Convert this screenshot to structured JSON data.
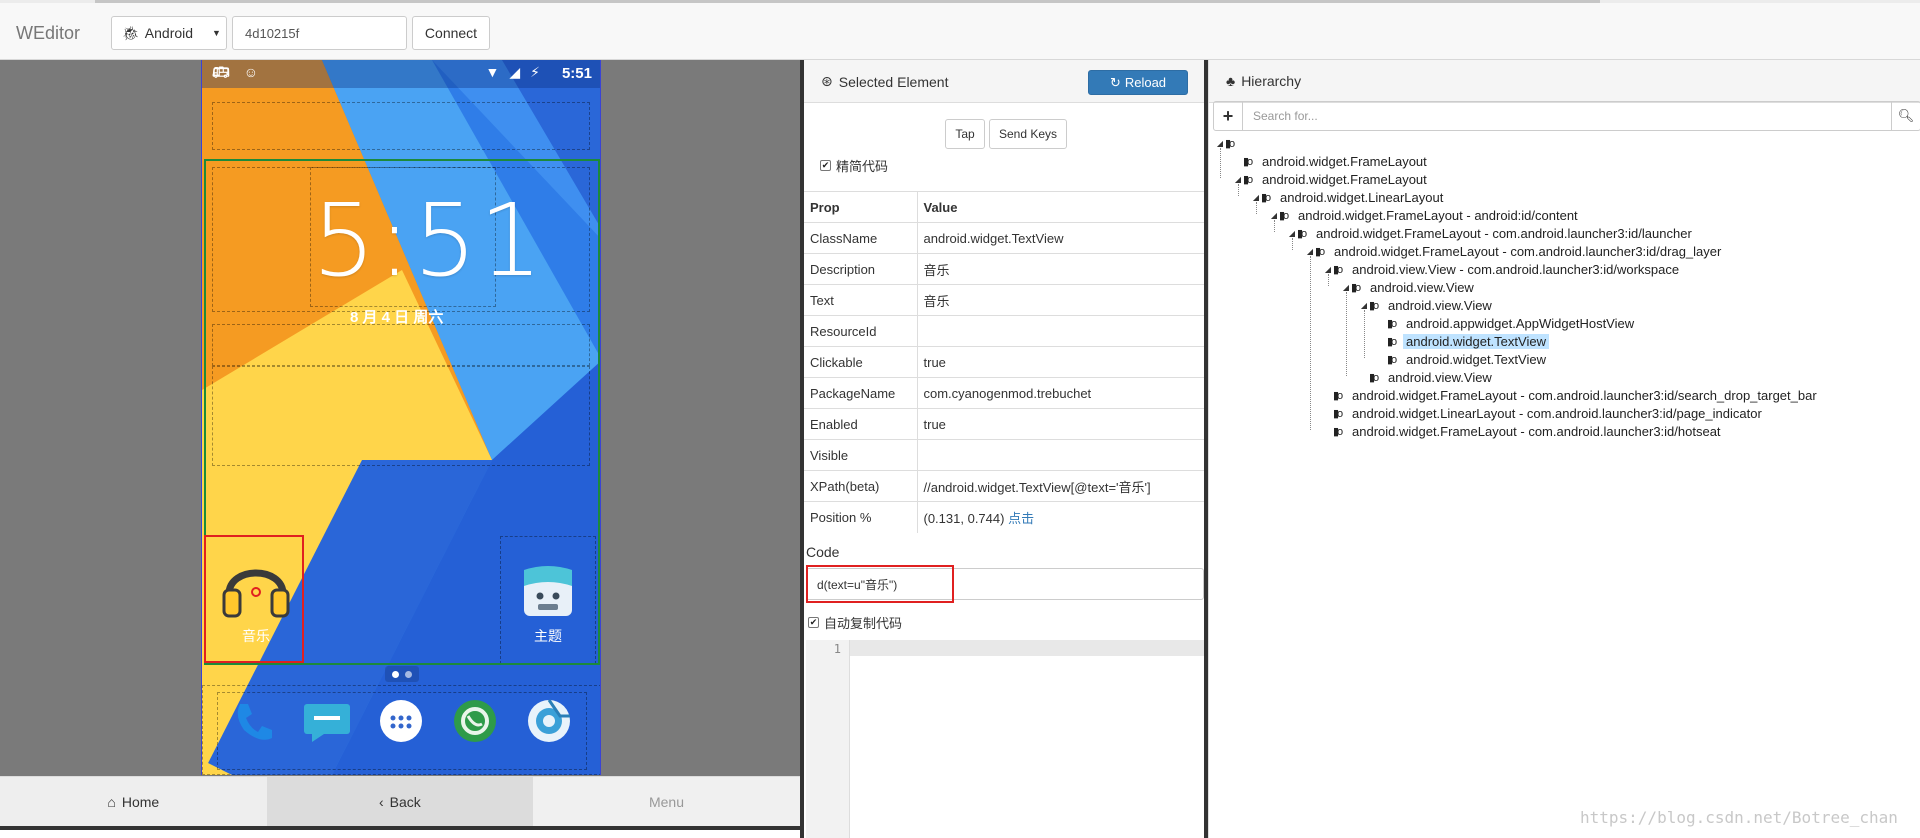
{
  "app": {
    "brand": "WEditor",
    "platform": "Android",
    "serial": "4d10215f",
    "connect_label": "Connect"
  },
  "device": {
    "status_time": "5:51",
    "clock": "5:51",
    "date": "8 月 4 日 周六",
    "apps": [
      {
        "label": "音乐",
        "icon": "headphones-icon"
      },
      {
        "label": "主题",
        "icon": "paint-bucket-icon"
      }
    ],
    "dock": [
      "phone-icon",
      "messaging-icon",
      "app-drawer-icon",
      "browser-icon",
      "camera-icon"
    ],
    "nav": {
      "home": "Home",
      "back": "Back",
      "menu": "Menu"
    }
  },
  "selected": {
    "title": "Selected Element",
    "reload_label": "Reload",
    "tap_label": "Tap",
    "send_keys_label": "Send Keys",
    "simplify_label": "精简代码",
    "simplify_checked": true,
    "table_head": {
      "prop": "Prop",
      "value": "Value"
    },
    "props": [
      {
        "k": "ClassName",
        "v": "android.widget.TextView"
      },
      {
        "k": "Description",
        "v": "音乐"
      },
      {
        "k": "Text",
        "v": "音乐"
      },
      {
        "k": "ResourceId",
        "v": ""
      },
      {
        "k": "Clickable",
        "v": "true"
      },
      {
        "k": "PackageName",
        "v": "com.cyanogenmod.trebuchet"
      },
      {
        "k": "Enabled",
        "v": "true"
      },
      {
        "k": "Visible",
        "v": ""
      },
      {
        "k": "XPath(beta)",
        "v": "//android.widget.TextView[@text='音乐']"
      },
      {
        "k": "Position %",
        "v": "(0.131, 0.744)",
        "link": "点击"
      }
    ],
    "code_label": "Code",
    "code": "d(text=u\"音乐\")",
    "auto_copy_label": "自动复制代码",
    "auto_copy_checked": true,
    "editor_line": "1"
  },
  "hierarchy": {
    "title": "Hierarchy",
    "search_placeholder": "Search for...",
    "nodes": [
      {
        "label": "",
        "depth": 0,
        "open": true
      },
      {
        "label": "android.widget.FrameLayout",
        "depth": 1,
        "open": false
      },
      {
        "label": "android.widget.FrameLayout",
        "depth": 1,
        "open": true
      },
      {
        "label": "android.widget.LinearLayout",
        "depth": 2,
        "open": true
      },
      {
        "label": "android.widget.FrameLayout - android:id/content",
        "depth": 3,
        "open": true
      },
      {
        "label": "android.widget.FrameLayout - com.android.launcher3:id/launcher",
        "depth": 4,
        "open": true
      },
      {
        "label": "android.widget.FrameLayout - com.android.launcher3:id/drag_layer",
        "depth": 5,
        "open": true
      },
      {
        "label": "android.view.View - com.android.launcher3:id/workspace",
        "depth": 6,
        "open": true
      },
      {
        "label": "android.view.View",
        "depth": 7,
        "open": true
      },
      {
        "label": "android.view.View",
        "depth": 8,
        "open": true
      },
      {
        "label": "android.appwidget.AppWidgetHostView",
        "depth": 9,
        "open": false
      },
      {
        "label": "android.widget.TextView",
        "depth": 9,
        "open": false,
        "selected": true
      },
      {
        "label": "android.widget.TextView",
        "depth": 9,
        "open": false
      },
      {
        "label": "android.view.View",
        "depth": 8,
        "open": false
      },
      {
        "label": "android.widget.FrameLayout - com.android.launcher3:id/search_drop_target_bar",
        "depth": 6,
        "open": false
      },
      {
        "label": "android.widget.LinearLayout - com.android.launcher3:id/page_indicator",
        "depth": 6,
        "open": false
      },
      {
        "label": "android.widget.FrameLayout - com.android.launcher3:id/hotseat",
        "depth": 6,
        "open": false
      }
    ]
  },
  "watermark": "https://blog.csdn.net/Botree_chan",
  "colors": {
    "accent": "#337ab7",
    "selection_red": "#e02020",
    "selection_green": "#1c8a3b",
    "tree_selected": "#bfe3ff"
  }
}
